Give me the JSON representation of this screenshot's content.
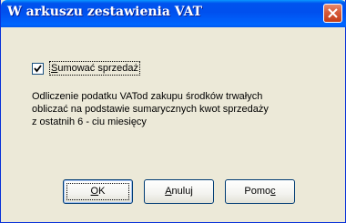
{
  "window": {
    "title": "W arkuszu zestawienia VAT",
    "close_icon": "close-icon"
  },
  "option": {
    "checked": true,
    "label_prefix": "",
    "label_underlined": "S",
    "label_rest": "umować sprzedaż"
  },
  "description": {
    "line1": "Odliczenie podatku VATod zakupu środków trwałych",
    "line2": "obliczać na podstawie sumarycznych kwot sprzedaży",
    "line3": "z ostatnih 6 - ciu miesięcy"
  },
  "buttons": {
    "ok": {
      "underlined": "O",
      "rest": "K",
      "prefix": ""
    },
    "cancel": {
      "prefix": "",
      "underlined": "A",
      "rest": "nuluj"
    },
    "help": {
      "prefix": "Pomo",
      "underlined": "c",
      "rest": ""
    }
  },
  "colors": {
    "title_bar": "#0053ee",
    "dialog_bg": "#ece9d8",
    "close_button": "#c33d18"
  }
}
